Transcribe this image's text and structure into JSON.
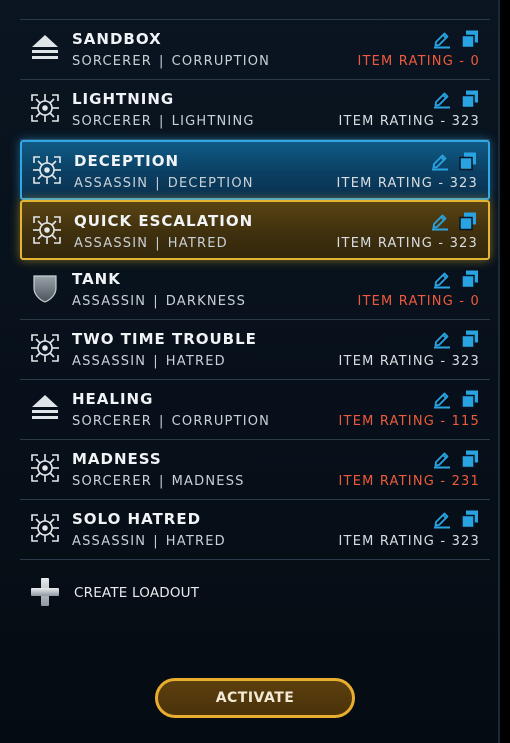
{
  "loadouts": [
    {
      "name": "SANDBOX",
      "class": "SORCERER",
      "discipline": "CORRUPTION",
      "rating": "ITEM RATING - 0",
      "rating_warn": true,
      "icon": "chevron-stack-icon",
      "state": "normal"
    },
    {
      "name": "LIGHTNING",
      "class": "SORCERER",
      "discipline": "LIGHTNING",
      "rating": "ITEM RATING - 323",
      "rating_warn": false,
      "icon": "crosshair-icon",
      "state": "normal"
    },
    {
      "name": "DECEPTION",
      "class": "ASSASSIN",
      "discipline": "DECEPTION",
      "rating": "ITEM RATING - 323",
      "rating_warn": false,
      "icon": "crosshair-icon",
      "state": "selected-blue"
    },
    {
      "name": "QUICK ESCALATION",
      "class": "ASSASSIN",
      "discipline": "HATRED",
      "rating": "ITEM RATING - 323",
      "rating_warn": false,
      "icon": "crosshair-icon",
      "state": "selected-gold"
    },
    {
      "name": "TANK",
      "class": "ASSASSIN",
      "discipline": "DARKNESS",
      "rating": "ITEM RATING - 0",
      "rating_warn": true,
      "icon": "shield-icon",
      "state": "normal"
    },
    {
      "name": "TWO TIME TROUBLE",
      "class": "ASSASSIN",
      "discipline": "HATRED",
      "rating": "ITEM RATING - 323",
      "rating_warn": false,
      "icon": "crosshair-icon",
      "state": "normal"
    },
    {
      "name": "HEALING",
      "class": "SORCERER",
      "discipline": "CORRUPTION",
      "rating": "ITEM RATING - 115",
      "rating_warn": true,
      "icon": "chevron-stack-icon",
      "state": "normal"
    },
    {
      "name": "MADNESS",
      "class": "SORCERER",
      "discipline": "MADNESS",
      "rating": "ITEM RATING - 231",
      "rating_warn": true,
      "icon": "crosshair-icon",
      "state": "normal"
    },
    {
      "name": "SOLO HATRED",
      "class": "ASSASSIN",
      "discipline": "HATRED",
      "rating": "ITEM RATING - 323",
      "rating_warn": false,
      "icon": "crosshair-icon",
      "state": "normal"
    }
  ],
  "separator": "|",
  "create_label": "CREATE LOADOUT",
  "activate_label": "ACTIVATE",
  "colors": {
    "accent_blue": "#31a7e6",
    "accent_gold": "#e3b531",
    "warning_red": "#ef5a3a",
    "icon_blue": "#2aa3e3"
  }
}
